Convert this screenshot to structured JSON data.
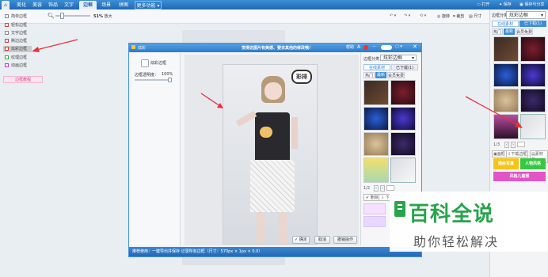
{
  "menubar": {
    "tabs": [
      {
        "label": "美化"
      },
      {
        "label": "美容"
      },
      {
        "label": "饰品"
      },
      {
        "label": "文字"
      },
      {
        "label": "边框"
      },
      {
        "label": "场景"
      },
      {
        "label": "拼图"
      },
      {
        "label": "更多功能"
      }
    ],
    "right": {
      "open": "打开",
      "save": "保存",
      "share": "保存与分享"
    }
  },
  "toolbar": {
    "zoom_label": "51%",
    "zoom_extra": "放大",
    "rotate": "旋转",
    "crop": "裁剪",
    "size": "尺寸"
  },
  "left_panel": {
    "items": [
      {
        "label": "简单边框"
      },
      {
        "label": "轻松边框"
      },
      {
        "label": "文字边框"
      },
      {
        "label": "撕边边框"
      },
      {
        "label": "炫彩边框"
      },
      {
        "label": "纹理边框"
      },
      {
        "label": "动画边框"
      }
    ],
    "promo": "边框教程"
  },
  "dialog": {
    "title": "炫彩",
    "header_text": "觉得这图片有美感、要去其他的修改哦！",
    "left_title": "炫彩边框",
    "slider_label": "边框透明度：",
    "slider_value": "100%",
    "photo_text": "彩排",
    "right": {
      "category_label": "边框分类",
      "category_value": "炫彩边框",
      "tabs": [
        "在线素材",
        "已下载(1)"
      ],
      "subtabs": [
        "热门",
        "最新",
        "会员免费"
      ],
      "pager": "1/2",
      "footer_btns": [
        "删除",
        "下载"
      ]
    },
    "buttons": {
      "ok": "确定",
      "cancel": "取消",
      "reset": "撤销操作"
    },
    "status": "推荐使用：一键导出并保存  记录所有边框（尺寸：570px × 1px × 0.0）"
  },
  "right_panel": {
    "category_label": "边框分类",
    "category_value": "炫彩边框",
    "tabs": [
      "在线素材",
      "已下载(1)"
    ],
    "subtabs": [
      "热门",
      "最新",
      "会员免费"
    ],
    "pager": "1/3",
    "actions": [
      "画框",
      "下载边框",
      "素材包"
    ],
    "cards": [
      {
        "text": "婚纱写真",
        "bg": "#f4c518",
        "fg": "#ffffff"
      },
      {
        "text": "人物风格",
        "bg": "#38c743",
        "fg": "#ffffff"
      },
      {
        "text": "风格儿童照",
        "bg": "#e254c8",
        "fg": "#ffffff"
      }
    ]
  },
  "watermark": {
    "title": "百科全说",
    "subtitle": "助你轻松解决",
    "color": "#1fa245"
  },
  "colors": {
    "accent": "#2b7bcb",
    "arrow": "#e8303a"
  }
}
